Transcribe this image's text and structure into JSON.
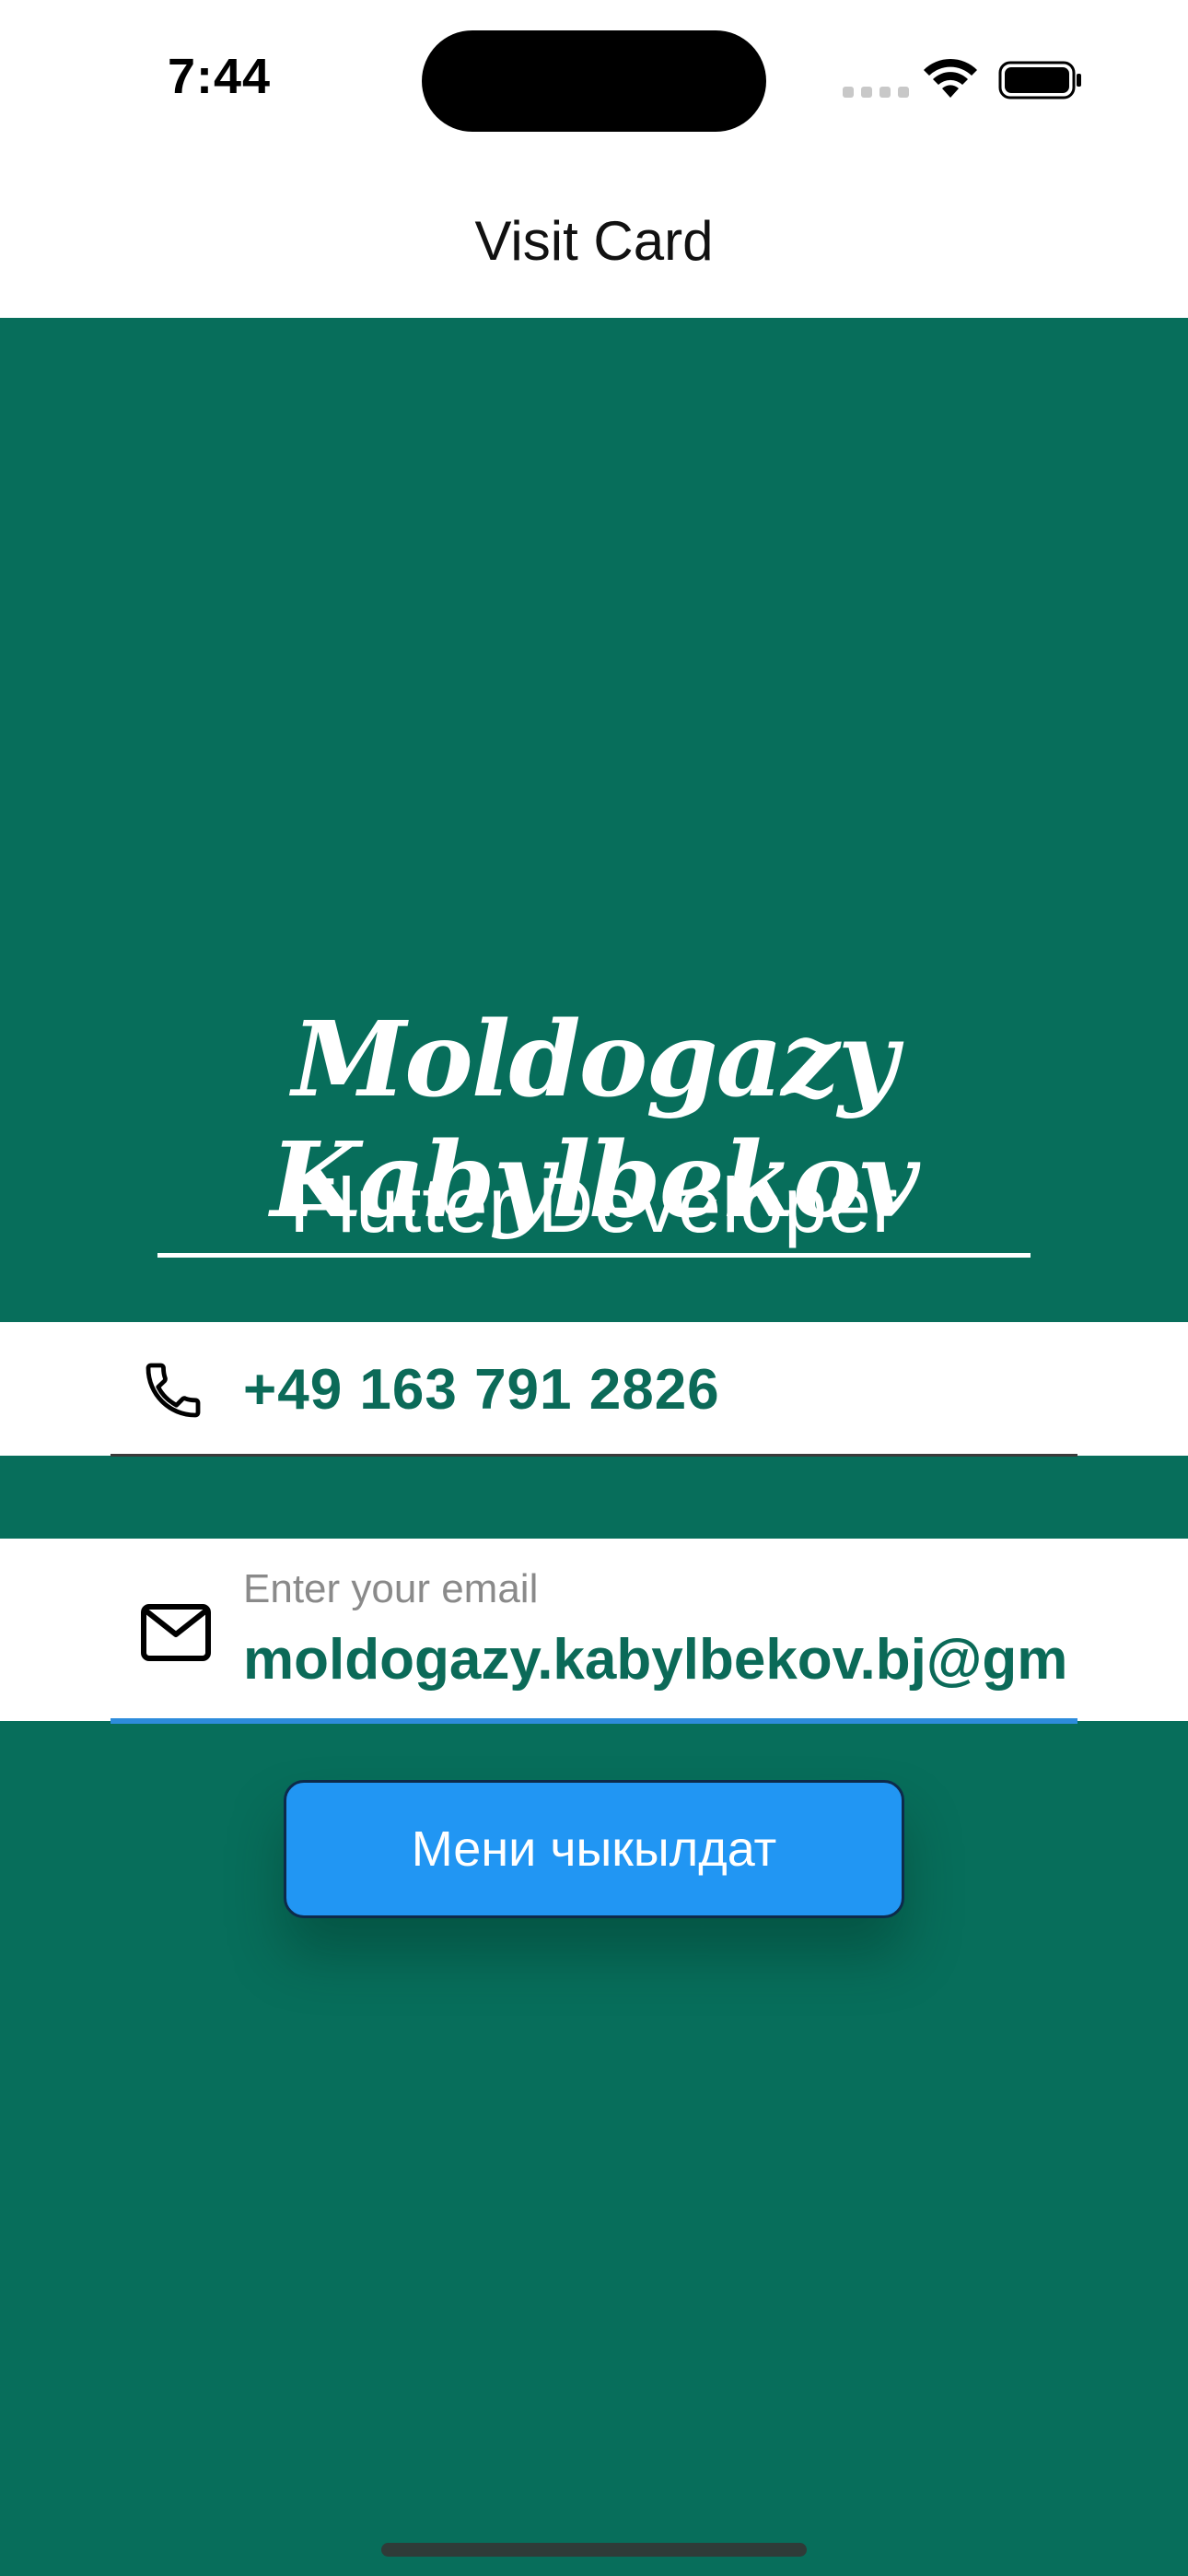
{
  "status_bar": {
    "time": "7:44",
    "icons": [
      "signal-icon",
      "wifi-icon",
      "battery-icon"
    ]
  },
  "app_bar": {
    "title": "Visit Card"
  },
  "profile": {
    "name": "Moldogazy Kabylbekov",
    "role": "Flutter Developer"
  },
  "phone": {
    "icon": "phone-icon",
    "value": "+49 163 791 2826"
  },
  "email": {
    "icon": "mail-icon",
    "label": "Enter your email",
    "value": "moldogazy.kabylbekov.bj@gm"
  },
  "button": {
    "label": "Мени чыкылдат"
  },
  "colors": {
    "background": "#076e5b",
    "accent_text": "#0b6a58",
    "button": "#2196f3",
    "focus_underline": "#2d8cdc"
  }
}
